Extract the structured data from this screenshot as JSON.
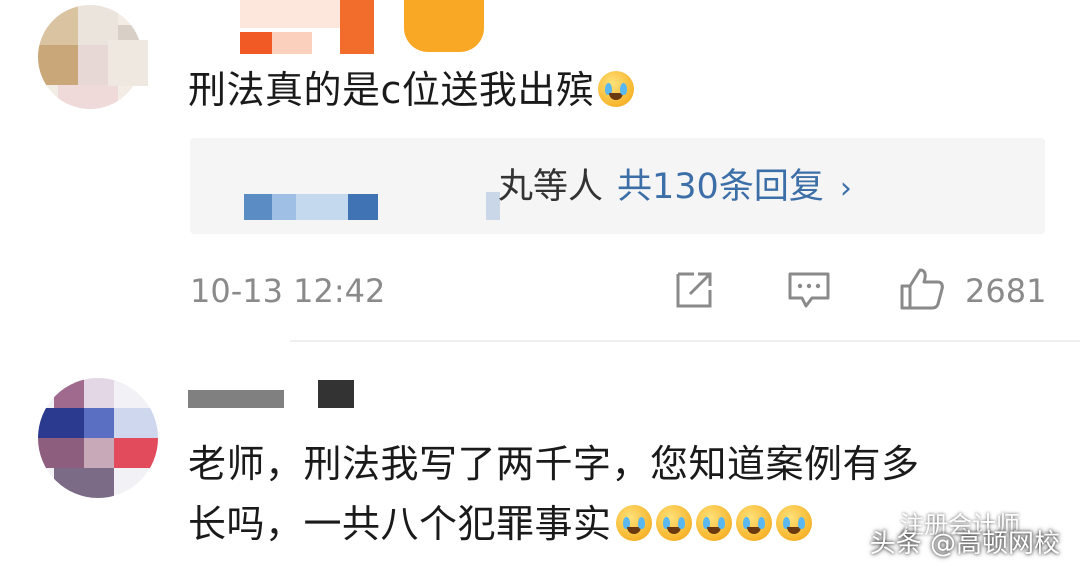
{
  "comment1": {
    "text": "刑法真的是c位送我出殡",
    "emoji": "crying-emoji",
    "replies": {
      "names": "丸等人",
      "count": "共130条回复",
      "chevron": "›"
    },
    "time": "10-13 12:42",
    "icons": [
      "share-icon",
      "comment-icon",
      "like-icon"
    ],
    "likes": "2681"
  },
  "comment2": {
    "line1": "老师，刑法我写了两千字，您知道案例有多",
    "line2": "长吗，一共八个犯罪事实",
    "emoji_count": 5
  },
  "watermark": {
    "top": "注册会计师",
    "bottom": "头条 @高顿网校"
  },
  "colors": {
    "link": "#3c6ea8",
    "meta": "#8a8a8a",
    "reply_bg": "#f5f5f5"
  }
}
